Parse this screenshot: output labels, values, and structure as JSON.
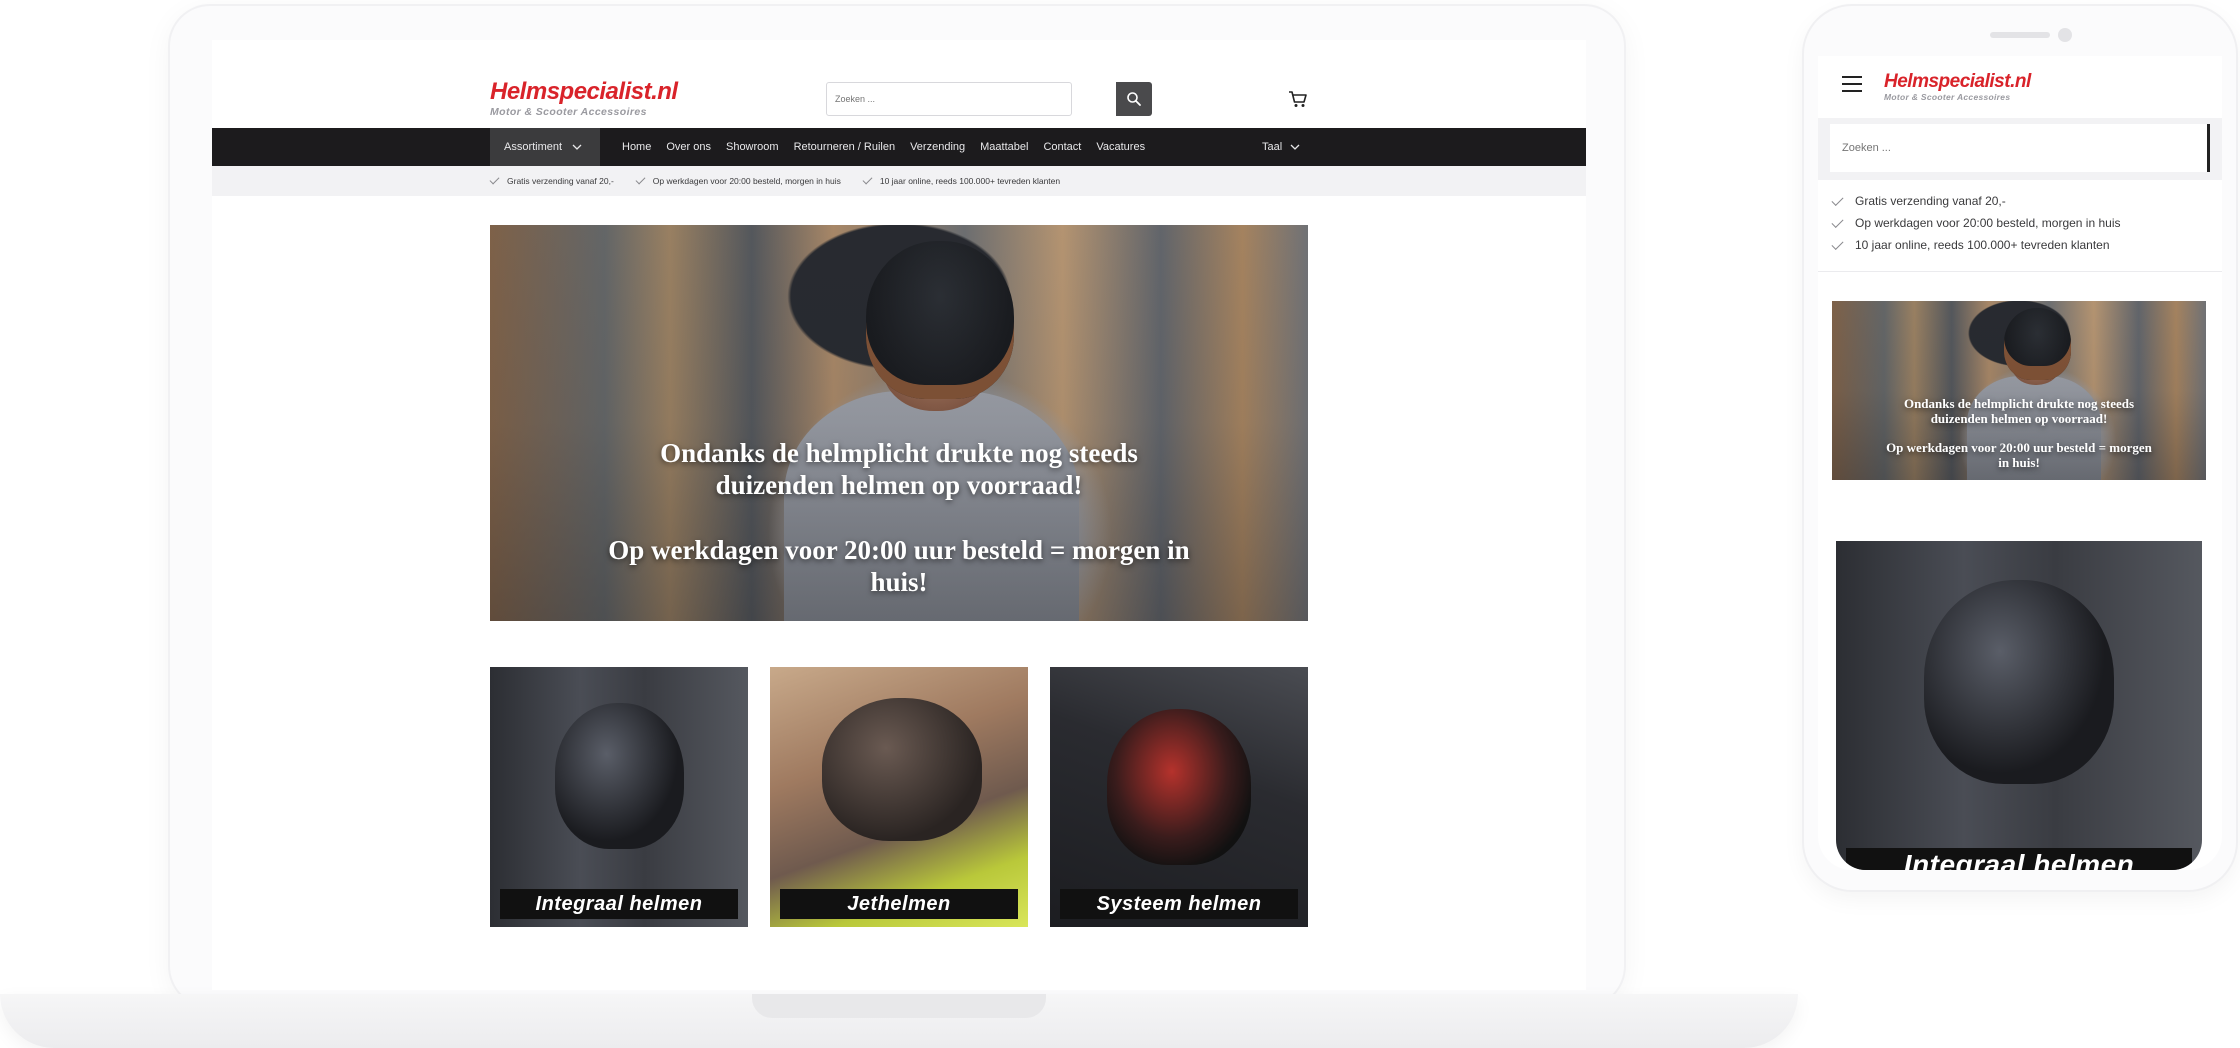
{
  "brand": {
    "name": "Helmspecialist.nl",
    "tagline": "Motor & Scooter Accessoires",
    "accent": "#d9232a",
    "nav_bg": "#1c1b1d"
  },
  "search": {
    "placeholder": "Zoeken ...",
    "value": ""
  },
  "nav": {
    "assortiment": "Assortiment",
    "links": [
      "Home",
      "Over ons",
      "Showroom",
      "Retourneren / Ruilen",
      "Verzending",
      "Maattabel",
      "Contact",
      "Vacatures"
    ],
    "language": "Taal"
  },
  "usps": [
    "Gratis verzending vanaf 20,-",
    "Op werkdagen voor 20:00 besteld, morgen in huis",
    "10 jaar online, reeds 100.000+ tevreden klanten"
  ],
  "hero": {
    "line1": "Ondanks de helmplicht drukte nog steeds duizenden helmen op voorraad!",
    "line2": "Op werkdagen voor 20:00 uur besteld = morgen in huis!"
  },
  "categories": [
    "Integraal helmen",
    "Jethelmen",
    "Systeem helmen"
  ],
  "mobile": {
    "search_placeholder": "Zoeken ...",
    "category": "Integraal helmen"
  },
  "icons": {
    "search": "search-icon",
    "cart": "cart-icon",
    "menu": "hamburger-icon",
    "check": "check-icon",
    "chevron": "chevron-down-icon"
  }
}
